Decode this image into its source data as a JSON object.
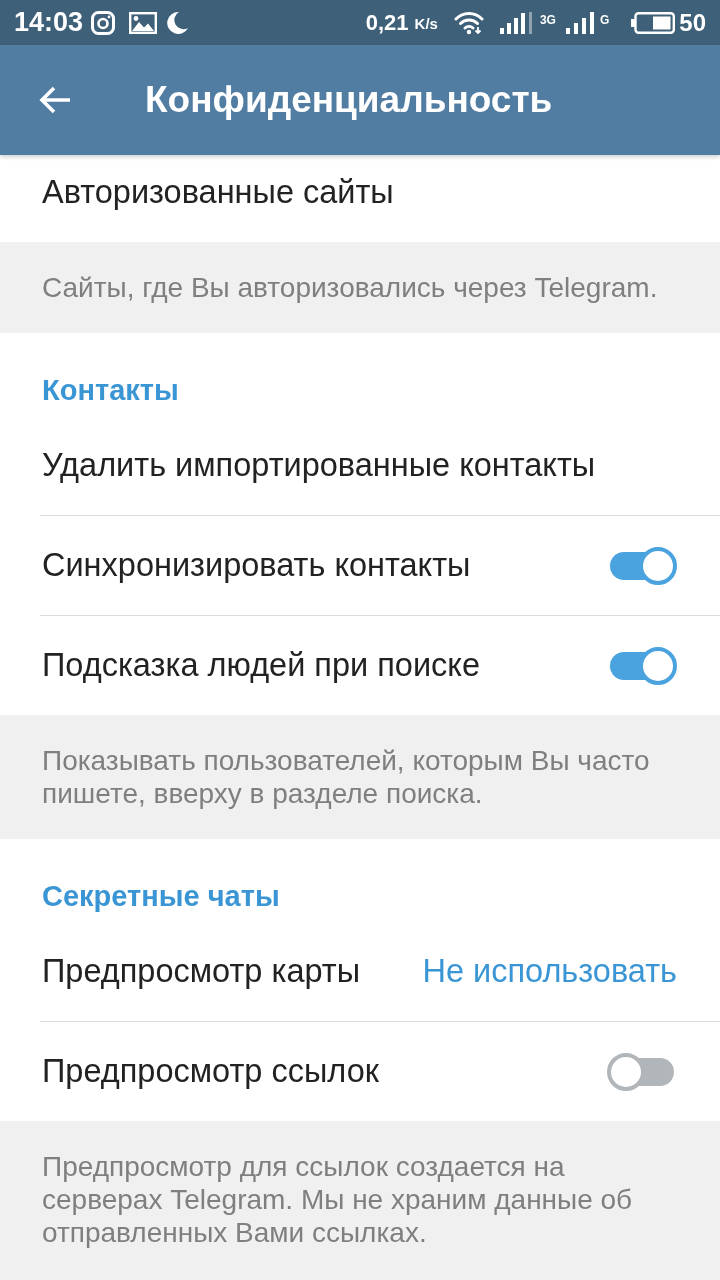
{
  "status_bar": {
    "time": "14:03",
    "speed": "0,21",
    "speed_unit": "K/s",
    "network_1": "3G",
    "network_2": "G",
    "battery": "50"
  },
  "app_bar": {
    "title": "Конфиденциальность"
  },
  "sections": [
    {
      "rows": [
        {
          "kind": "link",
          "label": "Авторизованные сайты"
        }
      ],
      "hint": "Сайты, где Вы авторизовались через Telegram."
    },
    {
      "header": "Контакты",
      "rows": [
        {
          "kind": "link",
          "label": "Удалить импортированные контакты"
        },
        {
          "kind": "toggle",
          "label": "Синхронизировать контакты",
          "on": true
        },
        {
          "kind": "toggle",
          "label": "Подсказка людей при поиске",
          "on": true
        }
      ],
      "hint": "Показывать пользователей, которым Вы часто пишете, вверху в разделе поиска."
    },
    {
      "header": "Секретные чаты",
      "rows": [
        {
          "kind": "value",
          "label": "Предпросмотр карты",
          "value": "Не использовать"
        },
        {
          "kind": "toggle",
          "label": "Предпросмотр ссылок",
          "on": false
        }
      ],
      "hint": "Предпросмотр для ссылок создается на серверах Telegram. Мы не храним данные об отправленных Вами ссылках."
    }
  ]
}
